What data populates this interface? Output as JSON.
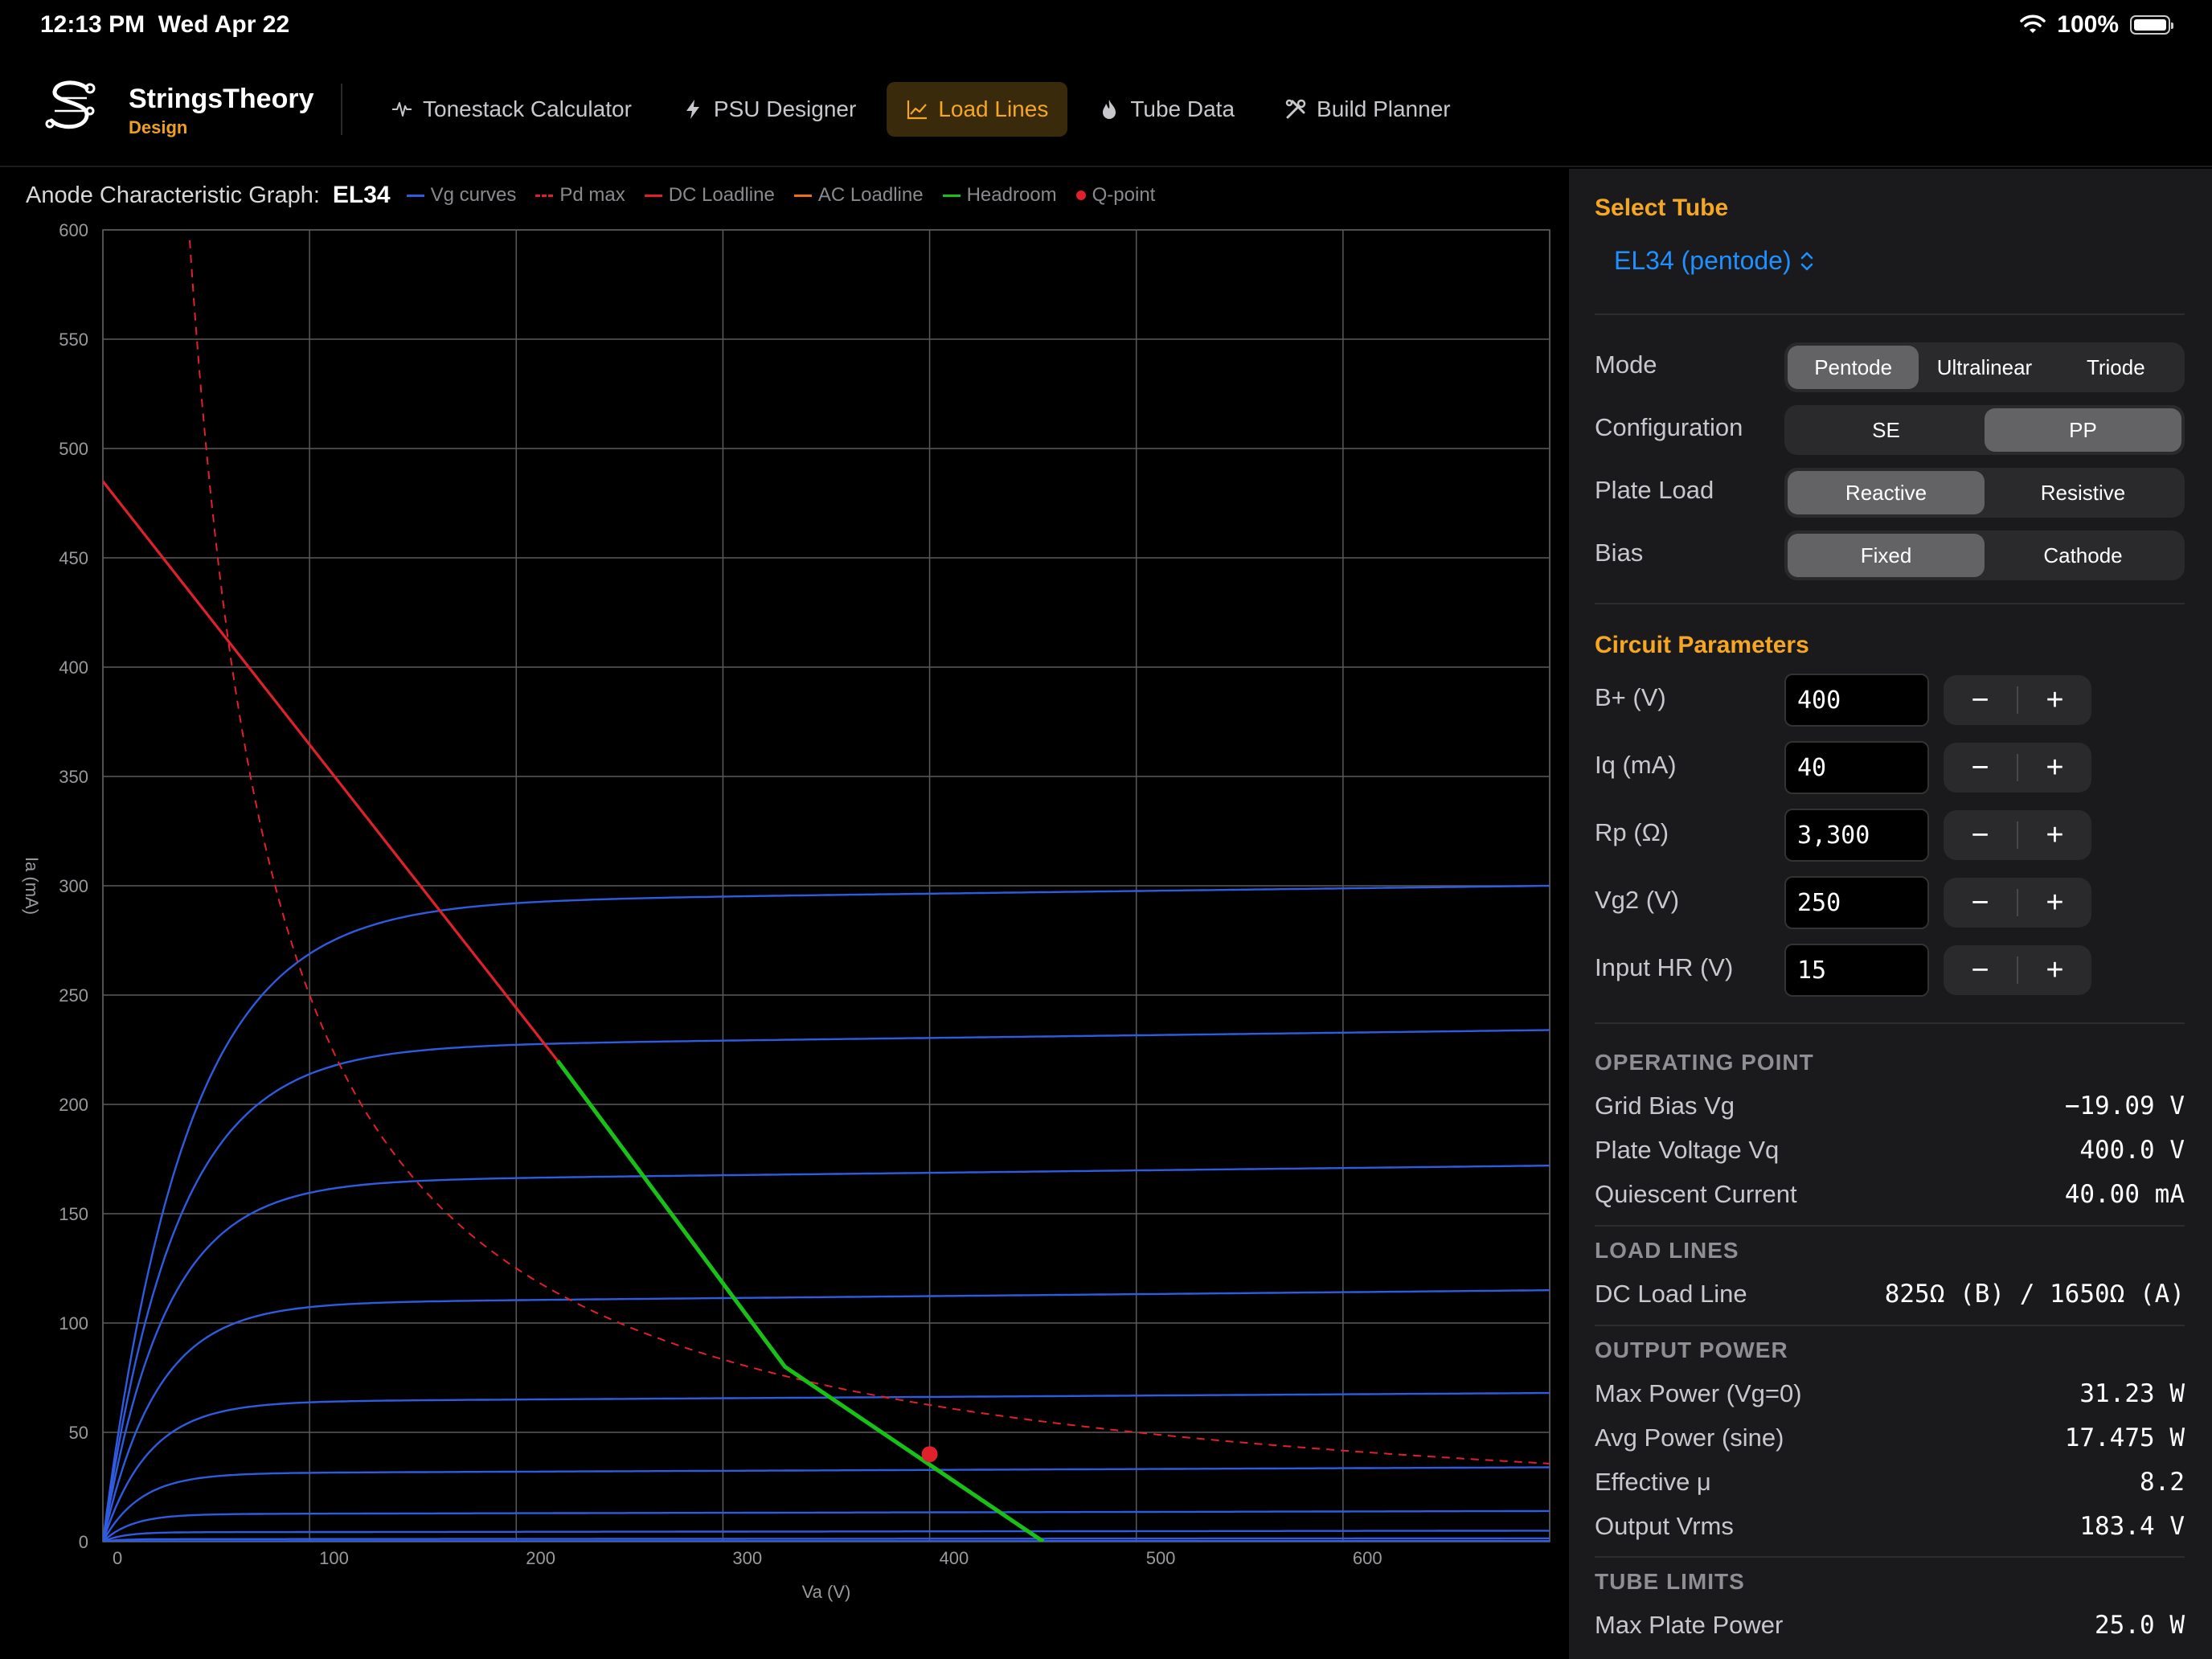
{
  "status": {
    "time": "12:13 PM",
    "date": "Wed Apr 22",
    "battery": "100%"
  },
  "brand": {
    "name": "StringsTheory",
    "sub": "Design"
  },
  "nav": [
    {
      "label": "Tonestack Calculator",
      "icon": "waveform-icon"
    },
    {
      "label": "PSU Designer",
      "icon": "bolt-icon"
    },
    {
      "label": "Load Lines",
      "icon": "line-chart-icon",
      "active": true
    },
    {
      "label": "Tube Data",
      "icon": "flame-icon"
    },
    {
      "label": "Build Planner",
      "icon": "tools-icon"
    }
  ],
  "graph": {
    "title": "Anode Characteristic Graph:",
    "tube": "EL34",
    "legend": [
      {
        "label": "Vg curves",
        "color": "#2f5be0",
        "style": "solid"
      },
      {
        "label": "Pd max",
        "color": "#e0202a",
        "style": "dashed"
      },
      {
        "label": "DC Loadline",
        "color": "#e0202a",
        "style": "solid"
      },
      {
        "label": "AC Loadline",
        "color": "#f07010",
        "style": "solid"
      },
      {
        "label": "Headroom",
        "color": "#18c018",
        "style": "solid"
      },
      {
        "label": "Q-point",
        "color": "#e0202a",
        "style": "dot"
      }
    ]
  },
  "chart_data": {
    "type": "line",
    "xlabel": "Va (V)",
    "ylabel": "Ia (mA)",
    "xlim": [
      0,
      700
    ],
    "ylim": [
      0,
      600
    ],
    "xticks": [
      0,
      100,
      200,
      300,
      400,
      500,
      600
    ],
    "yticks": [
      0,
      50,
      100,
      150,
      200,
      250,
      300,
      350,
      400,
      450,
      500,
      550,
      600
    ],
    "grid": true,
    "vg_curves": {
      "color": "#2f5be0",
      "plateaus_mA": [
        300,
        234,
        172,
        115,
        68,
        34,
        14,
        5,
        1.5,
        0.3
      ],
      "knee_V": [
        40,
        35,
        30,
        26,
        22,
        18,
        14,
        10,
        8,
        6
      ],
      "slope_mA_per_V": [
        0.012,
        0.012,
        0.011,
        0.009,
        0.006,
        0.004,
        0.002,
        0.001,
        0.0005,
        0.0001
      ]
    },
    "pd_max": {
      "power_W": 25.0,
      "color": "#e0202a"
    },
    "dc_loadline": {
      "points": [
        [
          0,
          485
        ],
        [
          220,
          220
        ]
      ],
      "color": "#e0202a"
    },
    "headroom": {
      "points": [
        [
          220,
          220
        ],
        [
          330,
          80
        ],
        [
          455,
          0
        ]
      ],
      "color": "#18c018"
    },
    "q_point": {
      "x": 400,
      "y": 40,
      "color": "#e0202a"
    }
  },
  "panel": {
    "select_tube_title": "Select Tube",
    "tube": "EL34 (pentode)",
    "mode": {
      "label": "Mode",
      "options": [
        "Pentode",
        "Ultralinear",
        "Triode"
      ],
      "selected": 0
    },
    "configuration": {
      "label": "Configuration",
      "options": [
        "SE",
        "PP"
      ],
      "selected": 1
    },
    "plate_load": {
      "label": "Plate Load",
      "options": [
        "Reactive",
        "Resistive"
      ],
      "selected": 0
    },
    "bias": {
      "label": "Bias",
      "options": [
        "Fixed",
        "Cathode"
      ],
      "selected": 0
    },
    "circuit_title": "Circuit Parameters",
    "params": [
      {
        "label": "B+ (V)",
        "value": "400"
      },
      {
        "label": "Iq (mA)",
        "value": "40"
      },
      {
        "label": "Rp (Ω)",
        "value": "3,300"
      },
      {
        "label": "Vg2 (V)",
        "value": "250"
      },
      {
        "label": "Input HR (V)",
        "value": "15"
      }
    ],
    "stepper": {
      "minus": "−",
      "plus": "+"
    },
    "operating_point": {
      "title": "OPERATING POINT",
      "rows": [
        {
          "label": "Grid Bias Vg",
          "value": "−19.09 V"
        },
        {
          "label": "Plate Voltage Vq",
          "value": "400.0 V"
        },
        {
          "label": "Quiescent Current",
          "value": "40.00 mA"
        }
      ]
    },
    "load_lines": {
      "title": "LOAD LINES",
      "rows": [
        {
          "label": "DC Load Line",
          "value": "825Ω (B) / 1650Ω (A)"
        }
      ]
    },
    "output_power": {
      "title": "OUTPUT POWER",
      "rows": [
        {
          "label": "Max Power (Vg=0)",
          "value": "31.23 W"
        },
        {
          "label": "Avg Power (sine)",
          "value": "17.475 W"
        },
        {
          "label": "Effective μ",
          "value": "8.2"
        },
        {
          "label": "Output Vrms",
          "value": "183.4 V"
        }
      ]
    },
    "tube_limits": {
      "title": "TUBE LIMITS",
      "rows": [
        {
          "label": "Max Plate Power",
          "value": "25.0 W"
        }
      ]
    }
  }
}
